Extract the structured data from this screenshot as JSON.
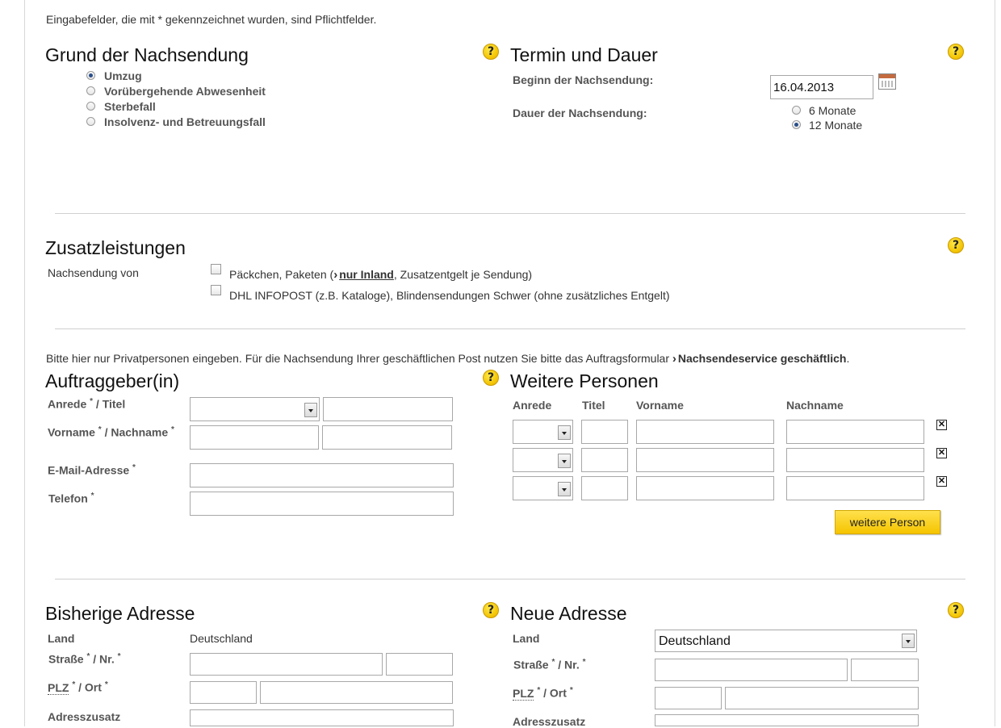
{
  "intro_note": "Eingabefelder, die mit * gekennzeichnet wurden, sind Pflichtfelder.",
  "help_glyph": "?",
  "grund": {
    "title": "Grund der Nachsendung",
    "options": [
      "Umzug",
      "Vorübergehende Abwesenheit",
      "Sterbefall",
      "Insolvenz- und Betreuungsfall"
    ],
    "selected_index": 0
  },
  "termin": {
    "title": "Termin und Dauer",
    "beginn_label": "Beginn der Nachsendung:",
    "beginn_value": "16.04.2013",
    "dauer_label": "Dauer der Nachsendung:",
    "dauer_options": [
      "6 Monate",
      "12 Monate"
    ],
    "dauer_selected_index": 1
  },
  "zusatz": {
    "title": "Zusatzleistungen",
    "row_label": "Nachsendung von",
    "opt1_before": "Päckchen, Paketen (",
    "opt1_link": "nur Inland",
    "opt1_after": ", Zusatzentgelt je Sendung)",
    "opt2": "DHL INFOPOST (z.B. Kataloge), Blindensendungen Schwer (ohne zusätzliches Entgelt)"
  },
  "privat_note_before": "Bitte hier nur Privatpersonen eingeben. Für die Nachsendung Ihrer geschäftlichen Post nutzen Sie bitte das Auftragsformular",
  "privat_note_link": "Nachsendeservice geschäftlich",
  "privat_note_after": ".",
  "auftraggeber": {
    "title": "Auftraggeber(in)",
    "anrede_label": "Anrede",
    "titel_label": "/ Titel",
    "vorname_label": "Vorname",
    "nachname_label": "/ Nachname",
    "email_label": "E-Mail-Adresse",
    "telefon_label": "Telefon",
    "required_mark": "*"
  },
  "weitere": {
    "title": "Weitere Personen",
    "columns": [
      "Anrede",
      "Titel",
      "Vorname",
      "Nachname"
    ],
    "remove_glyph": "✕",
    "add_button": "weitere Person"
  },
  "bisherige": {
    "title": "Bisherige Adresse",
    "land_label": "Land",
    "land_value": "Deutschland",
    "strasse_label": "Straße",
    "nr_label": "/ Nr.",
    "plz_label": "PLZ",
    "ort_label": "/ Ort",
    "zusatz_label": "Adresszusatz"
  },
  "neue": {
    "title": "Neue Adresse",
    "land_label": "Land",
    "land_value": "Deutschland",
    "strasse_label": "Straße",
    "nr_label": "/ Nr.",
    "plz_label": "PLZ",
    "ort_label": "/ Ort",
    "zusatz_label": "Adresszusatz"
  }
}
